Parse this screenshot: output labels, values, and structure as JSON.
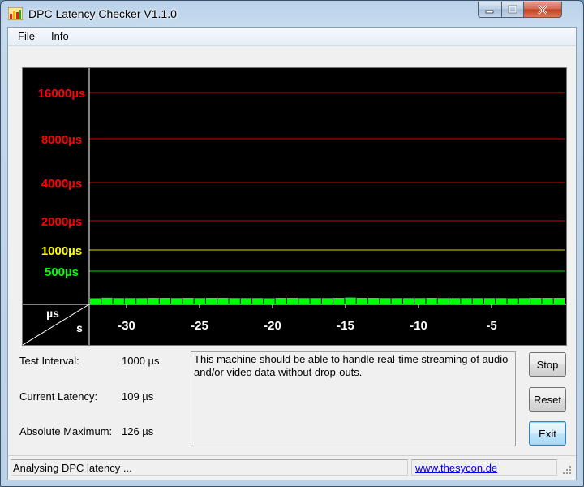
{
  "window": {
    "title": "DPC Latency Checker V1.1.0"
  },
  "menu": [
    "File",
    "Info"
  ],
  "graph": {
    "y_labels": [
      {
        "label": "16000µs",
        "color": "#ff0000"
      },
      {
        "label": "8000µs",
        "color": "#ff0000"
      },
      {
        "label": "4000µs",
        "color": "#ff0000"
      },
      {
        "label": "2000µs",
        "color": "#ff0000"
      },
      {
        "label": "1000µs",
        "color": "#ffff00"
      },
      {
        "label": "500µs",
        "color": "#00ff00"
      }
    ],
    "corner_top": "µs",
    "corner_bottom": "s",
    "x_labels": [
      "-30",
      "-25",
      "-20",
      "-15",
      "-10",
      "-5"
    ],
    "bar_color": "#00ff00",
    "bar_values_us": [
      109,
      121,
      113,
      113,
      113,
      118,
      118,
      113,
      118,
      113,
      118,
      118,
      113,
      113,
      113,
      109,
      118,
      118,
      113,
      113,
      113,
      118,
      126,
      118,
      118,
      113,
      113,
      113,
      113,
      118,
      113,
      113,
      113,
      113,
      113,
      113,
      109,
      113,
      118,
      118,
      118
    ]
  },
  "stats": [
    {
      "label": "Test Interval:",
      "value": "1000 µs"
    },
    {
      "label": "Current Latency:",
      "value": "109 µs"
    },
    {
      "label": "Absolute Maximum:",
      "value": "126 µs"
    }
  ],
  "message": "This machine should be able to handle real-time streaming of audio and/or video data without drop-outs.",
  "buttons": {
    "stop": "Stop",
    "reset": "Reset",
    "exit": "Exit"
  },
  "status": {
    "text": "Analysing DPC latency ...",
    "link": "www.thesycon.de"
  }
}
